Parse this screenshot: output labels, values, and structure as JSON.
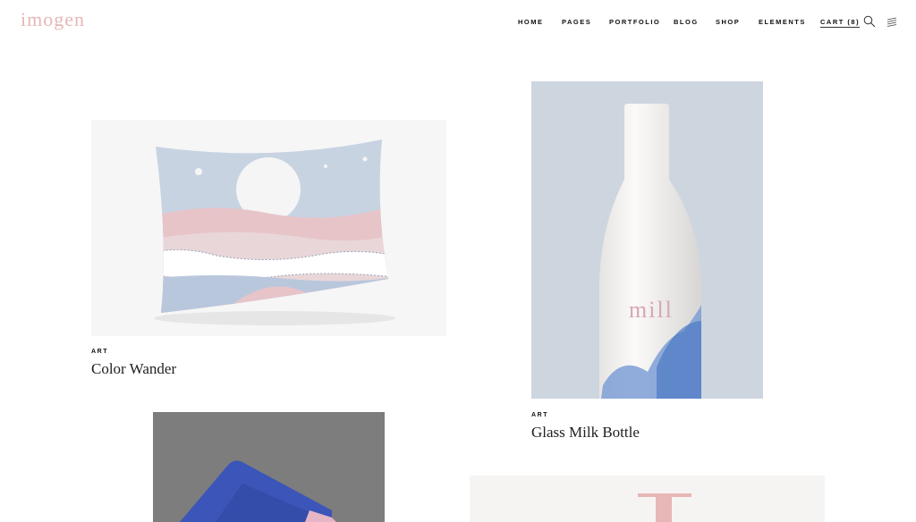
{
  "header": {
    "logo": "imogen",
    "nav": {
      "home": "HOME",
      "pages": "PAGES",
      "portfolio": "PORTFOLIO",
      "blog": "BLOG",
      "shop": "SHOP",
      "elements": "ELEMENTS",
      "cart": "CART (8)"
    },
    "icons": [
      "search-icon",
      "menu-icon"
    ]
  },
  "portfolio": {
    "items": [
      {
        "category": "ART",
        "title": "Color Wander"
      },
      {
        "category": "ART",
        "title": "Glass Milk Bottle"
      }
    ],
    "bottle_text": "mill"
  },
  "colors": {
    "accent": "#e7b6b6",
    "bottle_bg": "#cdd6df",
    "gray_bg": "#7d7d7d",
    "blue": "#3c55b8"
  }
}
